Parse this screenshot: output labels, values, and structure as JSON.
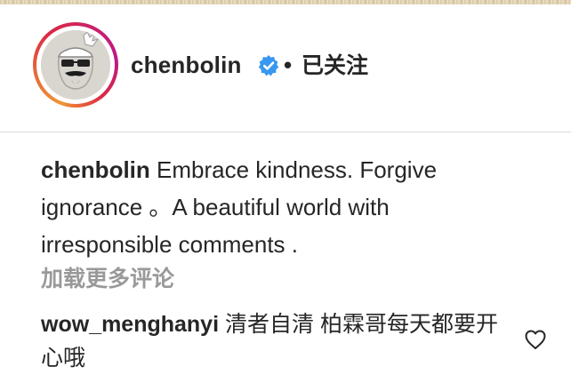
{
  "post_header": {
    "username": "chenbolin",
    "separator": "•",
    "follow_status": "已关注",
    "verified_icon": "verified-badge-icon",
    "verified_color": "#3897f0"
  },
  "caption": {
    "username": "chenbolin",
    "text": "Embrace kindness. Forgive ignorance 。A beautiful world with irresponsible comments ."
  },
  "load_more_comments": "加载更多评论",
  "comments": [
    {
      "username": "wow_menghanyi",
      "text": "清者自清 柏霖哥每天都要开心哦",
      "like_icon": "heart-outline-icon"
    }
  ],
  "colors": {
    "text": "#262626",
    "muted": "#999999",
    "divider": "#dbdbdb",
    "story_ring": [
      "#f09433",
      "#dc2743",
      "#bc1888"
    ]
  }
}
